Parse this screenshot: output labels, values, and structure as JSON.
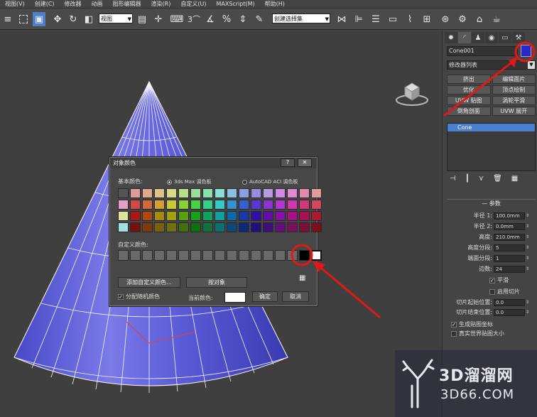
{
  "menu": [
    "视图(V)",
    "创建(C)",
    "修改器",
    "动画",
    "图形编辑器",
    "渲染(R)",
    "自定义(U)",
    "MAXScript(M)",
    "帮助(H)"
  ],
  "toolbar": {
    "view_select": "视图",
    "selection_set": "创建选择集",
    "snap_label": "3"
  },
  "command_panel": {
    "object_name": "Cone001",
    "object_color": "#2828c8",
    "modifier_list": "修改器列表",
    "mod_buttons": [
      "挤出",
      "编辑面片",
      "优化",
      "顶点绘制",
      "UVW 贴图",
      "涡轮平滑",
      "倒角剖面",
      "UVW 展开"
    ],
    "stack_item": "Cone",
    "rollout_title": "参数",
    "params": [
      {
        "label": "半径 1:",
        "value": "100.0mm"
      },
      {
        "label": "半径 2:",
        "value": "0.0mm"
      },
      {
        "label": "高度:",
        "value": "210.0mm"
      },
      {
        "label": "高度分段:",
        "value": "5"
      },
      {
        "label": "端面分段:",
        "value": "1"
      },
      {
        "label": "边数:",
        "value": "24"
      }
    ],
    "smooth_label": "平滑",
    "slice_label": "启用切片",
    "slice_from_label": "切片起始位置:",
    "slice_from_value": "0.0",
    "slice_to_label": "切片结束位置:",
    "slice_to_value": "0.0",
    "gen_map_label": "生成贴图坐标",
    "real_world_label": "真实世界贴图大小"
  },
  "dialog": {
    "title": "对象颜色",
    "help_btn": "?",
    "close_btn": "✕",
    "basic_colors_label": "基本颜色:",
    "radio_max": "3ds Max 调色板",
    "radio_autocad": "AutoCAD ACI 调色板",
    "custom_colors_label": "自定义颜色:",
    "add_custom_btn": "添加自定义颜色...",
    "by_object_btn": "按对象",
    "random_color_label": "分配随机颜色",
    "current_color_label": "当前颜色:",
    "current_color": "#ffffff",
    "ok_btn": "确定",
    "cancel_btn": "取消",
    "palette": [
      "#545454",
      "#e09a9a",
      "#e0a98a",
      "#e0c08a",
      "#d8d88a",
      "#b8e08a",
      "#9ae09a",
      "#8ae0b0",
      "#8ae0d8",
      "#8ac0e0",
      "#8aa0e0",
      "#9a8ae0",
      "#b89ae0",
      "#d08ae0",
      "#e08ad0",
      "#e08ab0",
      "#e09aa0",
      "#e0a0c8",
      "#d04848",
      "#d06a38",
      "#d0a030",
      "#c8c838",
      "#88d038",
      "#48d048",
      "#38d088",
      "#38c8c8",
      "#3890d0",
      "#3860d0",
      "#5838d0",
      "#8838d0",
      "#b038d0",
      "#d038b0",
      "#d03878",
      "#d04860",
      "#e0e0a0",
      "#a81818",
      "#b04810",
      "#a88810",
      "#a0a010",
      "#58a010",
      "#18a018",
      "#10a060",
      "#10a0a0",
      "#1068a8",
      "#1838a8",
      "#3010a8",
      "#6010a8",
      "#8810a8",
      "#a81088",
      "#a81050",
      "#a81830",
      "#a0e0e0",
      "#781010",
      "#803810",
      "#786010",
      "#707010",
      "#407010",
      "#107010",
      "#107040",
      "#107070",
      "#104878",
      "#102878",
      "#201078",
      "#401078",
      "#601078",
      "#781060",
      "#781038",
      "#781020"
    ],
    "custom_colors": [
      "#6a6a6a",
      "#6a6a6a",
      "#6a6a6a",
      "#6a6a6a",
      "#6a6a6a",
      "#6a6a6a",
      "#6a6a6a",
      "#6a6a6a",
      "#6a6a6a",
      "#6a6a6a",
      "#6a6a6a",
      "#6a6a6a",
      "#6a6a6a",
      "#6a6a6a",
      "#6a6a6a",
      "#000000",
      "#ffffff"
    ]
  },
  "watermark": {
    "brand": "3D溜溜网",
    "url": "3D66.COM"
  },
  "colors": {
    "annotation_red": "#e01818",
    "cone_blue": "#5c5cd8"
  }
}
